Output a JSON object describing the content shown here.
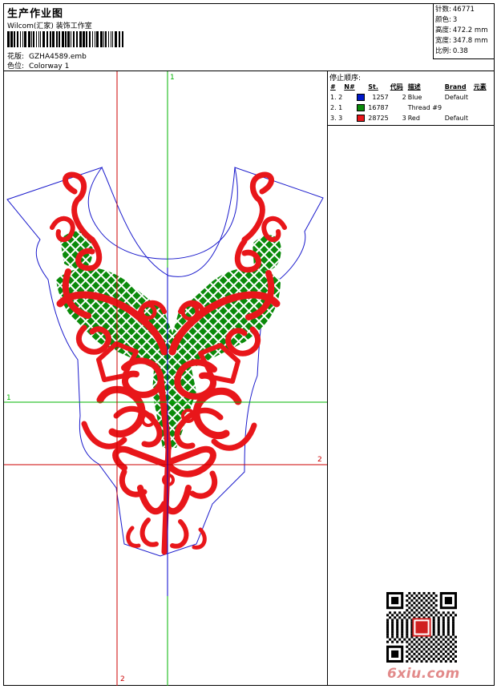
{
  "header": {
    "title": "生产作业图",
    "subtitle": "Wilcom(汇家) 装饰工作室",
    "design_label": "花版:",
    "design_value": "GZHA4589.emb",
    "colorway_label": "色位:",
    "colorway_value": "Colorway 1"
  },
  "stats": {
    "stitches_label": "针数:",
    "stitches_value": "46771",
    "colors_label": "颜色:",
    "colors_value": "3",
    "height_label": "高度:",
    "height_value": "472.2 mm",
    "width_label": "宽度:",
    "width_value": "347.8 mm",
    "scale_label": "比例:",
    "scale_value": "0.38"
  },
  "stop_sequence": {
    "title": "停止顺序:",
    "columns": [
      "#",
      "N#",
      "",
      "St.",
      "代码",
      "描述",
      "Brand",
      "元素"
    ],
    "rows": [
      {
        "index": "1. 2",
        "swatch": "#0018c8",
        "stitches": "1257",
        "code": "2",
        "description": "Blue",
        "brand": "Default"
      },
      {
        "index": "2. 1",
        "swatch": "#0a8a0a",
        "stitches": "16787",
        "code": "",
        "description": "Thread #9",
        "brand": ""
      },
      {
        "index": "3. 3",
        "swatch": "#e8161a",
        "stitches": "28725",
        "code": "3",
        "description": "Red",
        "brand": "Default"
      }
    ]
  },
  "guides": {
    "top": "1",
    "left": "1",
    "right": "2",
    "bottom": "2",
    "colors": {
      "green": "#00b400",
      "red": "#cc0000",
      "blue": "#0000cc"
    }
  },
  "embroidery_colors": {
    "outline": "#1a1acc",
    "fill": "#e8161a",
    "mesh": "#0a8a0a"
  },
  "watermark": "6xiu.com"
}
